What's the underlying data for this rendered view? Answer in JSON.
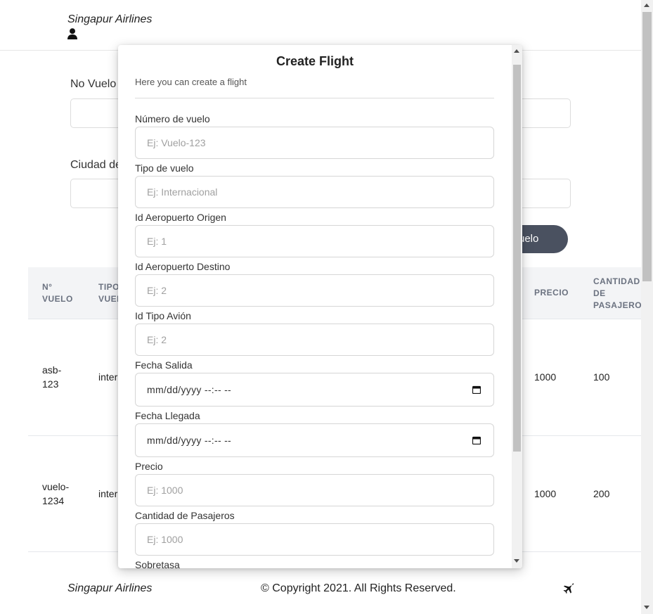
{
  "header": {
    "brand": "Singapur Airlines",
    "user_icon": "user-icon"
  },
  "search_form": {
    "no_vuelo_label": "No Vuelo",
    "ciudad_label": "Ciudad de",
    "button_label": "uelo"
  },
  "table": {
    "headers": {
      "n_vuelo": [
        "N°",
        "VUELO"
      ],
      "tipo_vuelo": [
        "TIPO",
        "VUEL"
      ],
      "precio": "PRECIO",
      "cantidad": [
        "CANTIDAD",
        "DE",
        "PASAJEROS"
      ]
    },
    "rows": [
      {
        "n_vuelo": [
          "asb-",
          "123"
        ],
        "tipo": "inter",
        "precio": "1000",
        "cantidad": "100"
      },
      {
        "n_vuelo": [
          "vuelo-",
          "1234"
        ],
        "tipo": "inter",
        "precio": "1000",
        "cantidad": "200"
      }
    ]
  },
  "modal": {
    "title": "Create Flight",
    "subtitle": "Here you can create a flight",
    "fields": {
      "numero": {
        "label": "Número de vuelo",
        "placeholder": "Ej: Vuelo-123"
      },
      "tipo": {
        "label": "Tipo de vuelo",
        "placeholder": "Ej: Internacional"
      },
      "origen": {
        "label": "Id Aeropuerto Origen",
        "placeholder": "Ej: 1"
      },
      "destino": {
        "label": "Id Aeropuerto Destino",
        "placeholder": "Ej: 2"
      },
      "avion": {
        "label": "Id Tipo Avión",
        "placeholder": "Ej: 2"
      },
      "salida": {
        "label": "Fecha Salida",
        "value": "mm/dd/yyyy --:-- --"
      },
      "llegada": {
        "label": "Fecha Llegada",
        "value": "mm/dd/yyyy --:-- --"
      },
      "precio": {
        "label": "Precio",
        "placeholder": "Ej: 1000"
      },
      "pasajeros": {
        "label": "Cantidad de Pasajeros",
        "placeholder": "Ej: 1000"
      },
      "sobretasa": {
        "label": "Sobretasa"
      }
    }
  },
  "footer": {
    "brand": "Singapur Airlines",
    "copyright": "© Copyright 2021. All Rights Reserved.",
    "icon": "plane-icon"
  },
  "colors": {
    "button_bg": "#4a5160",
    "table_header_bg": "#f3f4f6",
    "table_header_text": "#6b7280"
  }
}
